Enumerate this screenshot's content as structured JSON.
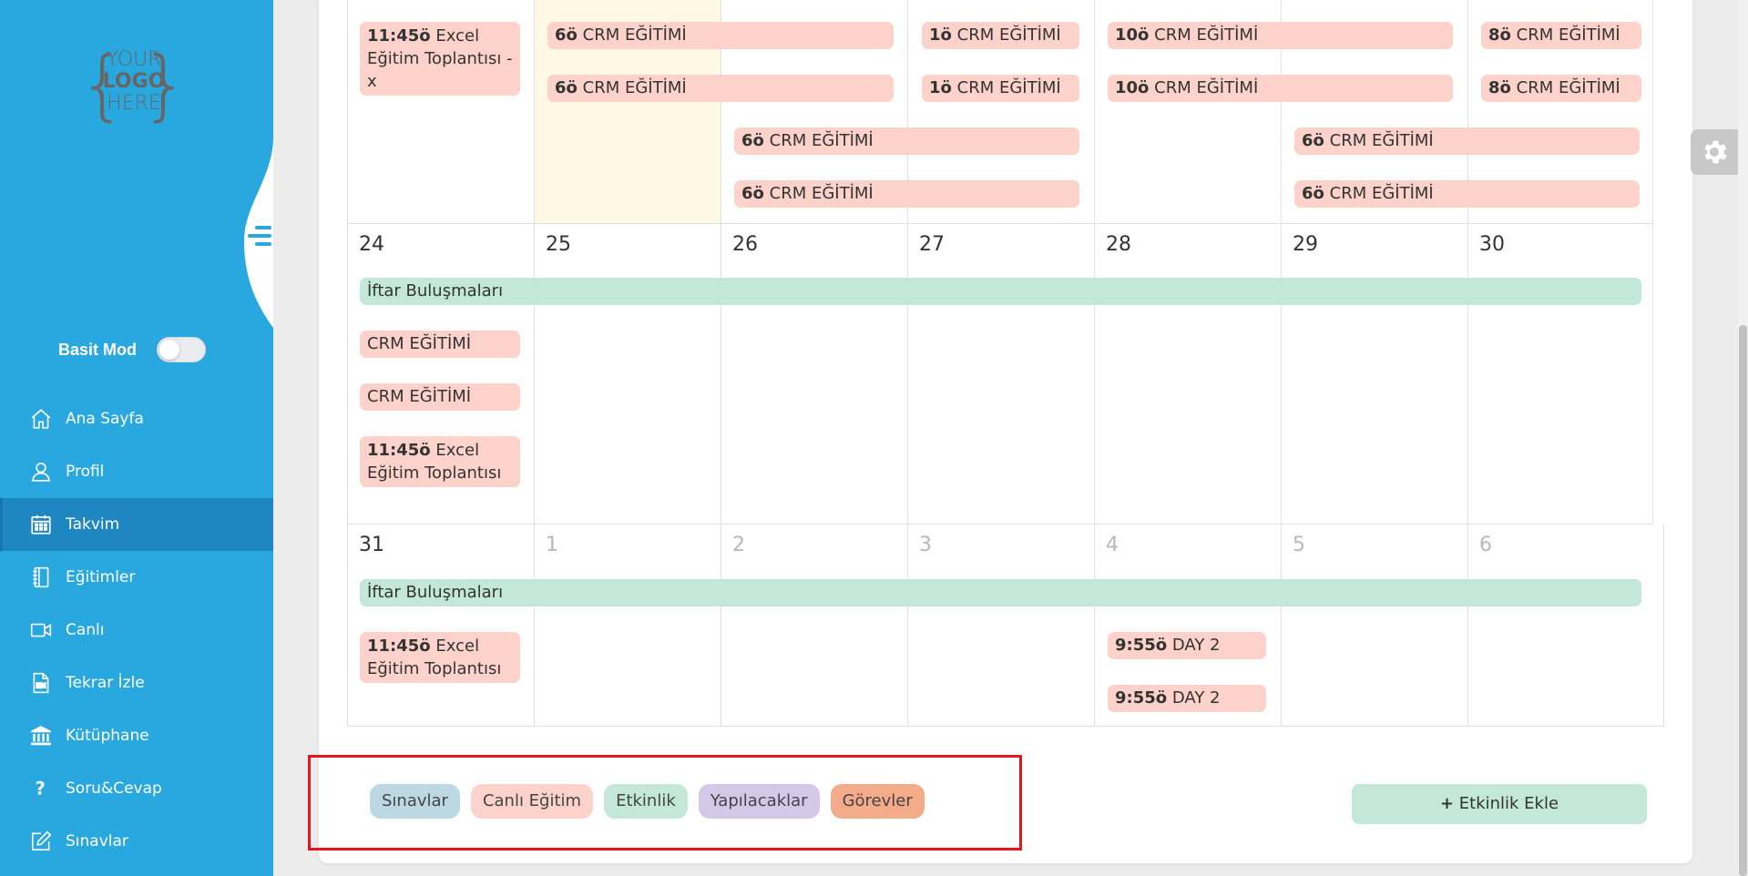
{
  "logo": {
    "line1": "YOUR",
    "line2": "LOGO",
    "line3": "HERE"
  },
  "sidebar": {
    "basit_mod_label": "Basit Mod",
    "items": [
      {
        "label": "Ana Sayfa",
        "icon": "home-icon"
      },
      {
        "label": "Profil",
        "icon": "user-icon"
      },
      {
        "label": "Takvim",
        "icon": "calendar-icon",
        "active": true
      },
      {
        "label": "Eğitimler",
        "icon": "notebook-icon"
      },
      {
        "label": "Canlı",
        "icon": "video-camera-icon"
      },
      {
        "label": "Tekrar İzle",
        "icon": "replay-video-icon"
      },
      {
        "label": "Kütüphane",
        "icon": "library-icon"
      },
      {
        "label": "Soru&Cevap",
        "icon": "question-icon"
      },
      {
        "label": "Sınavlar",
        "icon": "edit-icon"
      }
    ]
  },
  "calendar": {
    "week1": {
      "events": [
        {
          "time": "11:45ö",
          "title": "Excel Eğitim Toplantısı - x"
        },
        {
          "time": "6ö",
          "title": "CRM EĞİTİMİ"
        },
        {
          "time": "6ö",
          "title": "CRM EĞİTİMİ"
        },
        {
          "time": "1ö",
          "title": "CRM EĞİTİMİ"
        },
        {
          "time": "1ö",
          "title": "CRM EĞİTİMİ"
        },
        {
          "time": "10ö",
          "title": "CRM EĞİTİMİ"
        },
        {
          "time": "10ö",
          "title": "CRM EĞİTİMİ"
        },
        {
          "time": "8ö",
          "title": "CRM EĞİTİMİ"
        },
        {
          "time": "8ö",
          "title": "CRM EĞİTİMİ"
        },
        {
          "time": "6ö",
          "title": "CRM EĞİTİMİ"
        },
        {
          "time": "6ö",
          "title": "CRM EĞİTİMİ"
        },
        {
          "time": "6ö",
          "title": "CRM EĞİTİMİ"
        },
        {
          "time": "6ö",
          "title": "CRM EĞİTİMİ"
        }
      ]
    },
    "week2": {
      "days": [
        "24",
        "25",
        "26",
        "27",
        "28",
        "29",
        "30"
      ],
      "events": [
        {
          "title": "İftar Buluşmaları"
        },
        {
          "title": "CRM EĞİTİMİ"
        },
        {
          "title": "CRM EĞİTİMİ"
        },
        {
          "time": "11:45ö",
          "title": "Excel Eğitim Toplantısı"
        }
      ]
    },
    "week3": {
      "days": [
        "31",
        "1",
        "2",
        "3",
        "4",
        "5",
        "6"
      ],
      "events": [
        {
          "title": "İftar Buluşmaları"
        },
        {
          "time": "11:45ö",
          "title": "Excel Eğitim Toplantısı"
        },
        {
          "time": "9:55ö",
          "title": "DAY 2"
        },
        {
          "time": "9:55ö",
          "title": "DAY 2"
        }
      ]
    }
  },
  "legend": [
    {
      "label": "Sınavlar",
      "color": "#bcd9e3"
    },
    {
      "label": "Canlı Eğitim",
      "color": "#fdd2cb"
    },
    {
      "label": "Etkinlik",
      "color": "#c3e8da"
    },
    {
      "label": "Yapılacaklar",
      "color": "#d5c7e8"
    },
    {
      "label": "Görevler",
      "color": "#f4ab8a"
    }
  ],
  "add_event_label": "Etkinlik Ekle",
  "colors": {
    "sidebar": "#29a8e0",
    "sidebar_active": "#1e86c0",
    "event_pink": "#fdd2cb",
    "event_green": "#c3e8da",
    "today": "#fff8e4",
    "highlight_box": "#e8141b"
  }
}
